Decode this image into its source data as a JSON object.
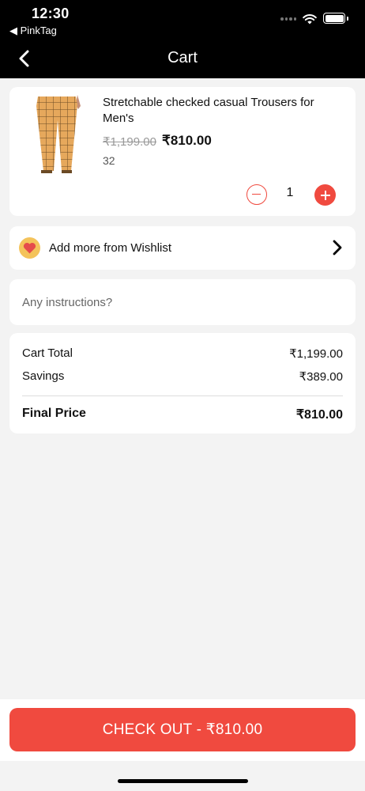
{
  "status_bar": {
    "time": "12:30",
    "back_app": "◀ PinkTag"
  },
  "nav": {
    "title": "Cart",
    "back_icon": "chevron-left-icon"
  },
  "cart_item": {
    "name": "Stretchable checked casual Trousers for Men's",
    "original_price": "₹1,199.00",
    "price": "₹810.00",
    "size": "32",
    "quantity": "1"
  },
  "wishlist": {
    "label": "Add more from Wishlist",
    "icon": "heart-icon"
  },
  "instructions": {
    "placeholder": "Any instructions?",
    "value": ""
  },
  "summary": {
    "cart_total_label": "Cart Total",
    "cart_total_value": "₹1,199.00",
    "savings_label": "Savings",
    "savings_value": "₹389.00",
    "final_label": "Final Price",
    "final_value": "₹810.00"
  },
  "checkout": {
    "label": "CHECK OUT - ₹810.00"
  },
  "colors": {
    "accent": "#f04a3f",
    "header": "#000000",
    "background": "#f3f3f3",
    "badge": "#f4c35b"
  }
}
